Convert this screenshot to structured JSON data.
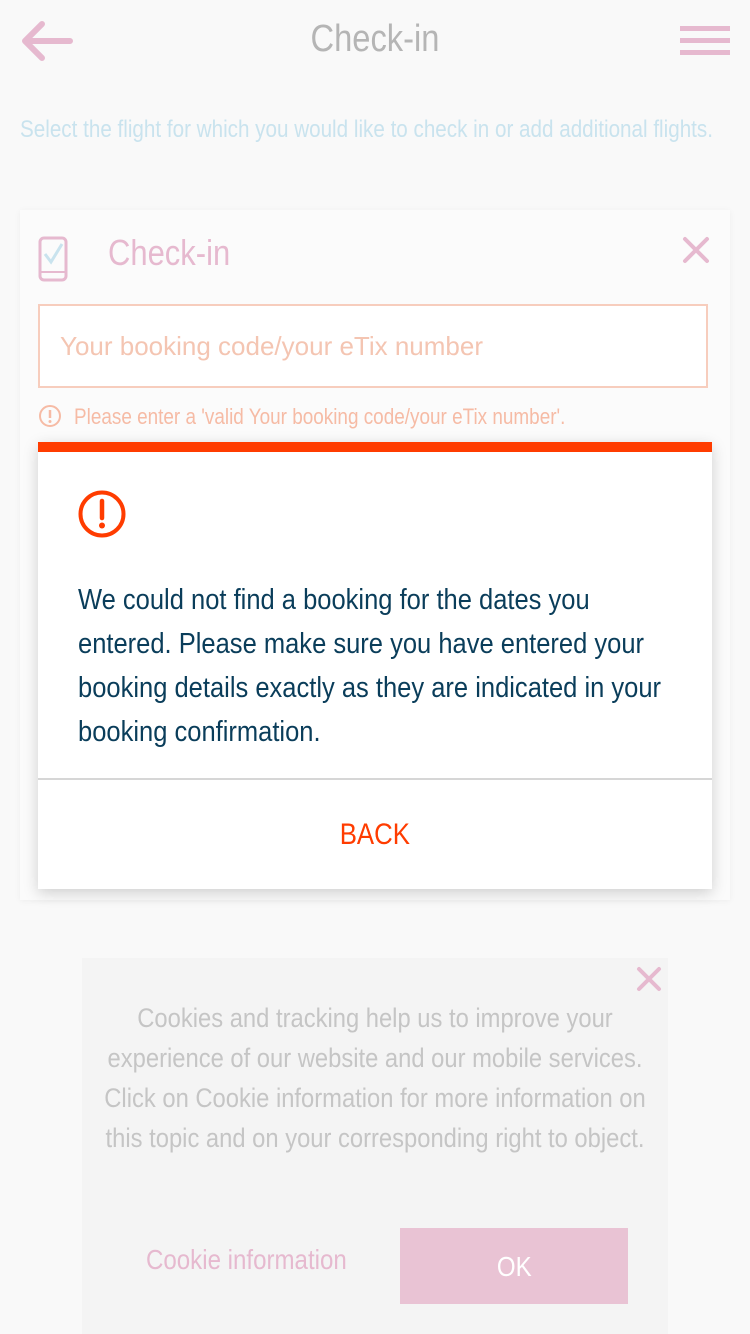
{
  "header": {
    "title": "Check-in",
    "back_icon": "arrow-left-icon",
    "menu_icon": "hamburger-menu-icon"
  },
  "intro_text": "Select the flight for which you would like to check in or add additional flights.",
  "checkin_card": {
    "icon": "phone-check-icon",
    "title": "Check-in",
    "close_icon": "close-icon",
    "booking_field": {
      "value": "",
      "placeholder": "Your booking code/your eTix number"
    },
    "error_icon": "alert-circle-icon",
    "error_text": "Please enter a 'valid Your booking code/your eTix number'."
  },
  "dialog": {
    "icon": "alert-circle-icon",
    "message": "We could not find a booking for the dates you entered. Please make sure you have entered your booking details exactly as they are indicated in your booking confirmation.",
    "back_label": "BACK"
  },
  "cookie_banner": {
    "close_icon": "close-icon",
    "text": "Cookies and tracking help us to improve your experience of our website and our mobile services. Click on Cookie information for more information on this topic and on your corresponding right to object.",
    "info_label": "Cookie information",
    "ok_label": "OK"
  },
  "colors": {
    "accent": "#ff3c00",
    "message": "#0a3d5a",
    "brand_pink": "#e6b9cf",
    "intro_blue": "#c9e3ee",
    "background": "#f9f9f9"
  }
}
